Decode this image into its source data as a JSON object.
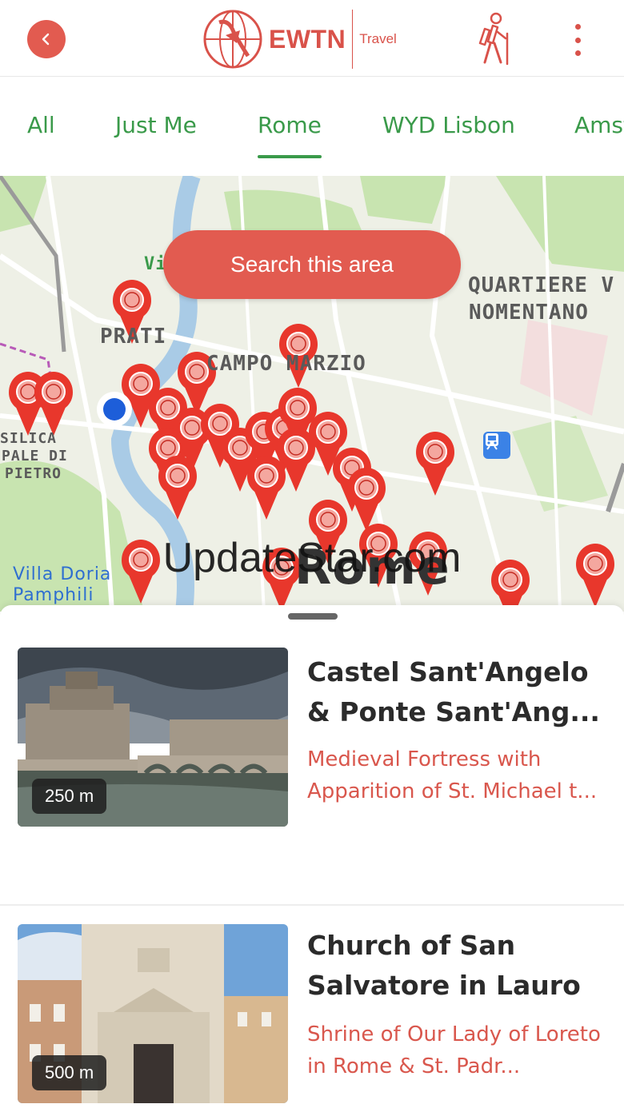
{
  "header": {
    "logo_text": "EWTN",
    "logo_subtitle": "Travel",
    "icons": {
      "back": "chevron-left-icon",
      "hiker": "hiker-icon",
      "menu": "kebab-menu-icon"
    }
  },
  "tabs": [
    {
      "label": "All"
    },
    {
      "label": "Just Me"
    },
    {
      "label": "Rome",
      "selected": true
    },
    {
      "label": "WYD Lisbon"
    },
    {
      "label": "Amst"
    }
  ],
  "map": {
    "search_button": "Search this area",
    "labels": {
      "prati": "PRATI",
      "campo_marzio": "CAMPO MARZIO",
      "quartiere_line1": "QUARTIERE V",
      "quartiere_line2": "NOMENTANO",
      "basilica_line1": "SILICA",
      "basilica_line2": "PALE DI",
      "basilica_line3": "PIETRO",
      "villa_line1": "Villa Doria",
      "villa_line2": "Pamphili",
      "vi": "Vi",
      "rome": "Rome"
    },
    "colors": {
      "pin": "#e8372c",
      "user_location": "#1d5ed9",
      "river": "#a9cbe6",
      "park": "#c8e4b0"
    }
  },
  "watermark": "UpdateStar.com",
  "places": [
    {
      "distance": "250 m",
      "title": "Castel Sant'Angelo & Ponte Sant'Ang...",
      "subtitle": "Medieval Fortress with Apparition of St. Michael t..."
    },
    {
      "distance": "500 m",
      "title": "Church of San Salvatore in Lauro",
      "subtitle": "Shrine of Our Lady of Loreto in Rome & St. Padr..."
    }
  ],
  "colors": {
    "accent": "#e25b50",
    "tab_green": "#3a9a4a",
    "subtitle_red": "#d9574d"
  }
}
